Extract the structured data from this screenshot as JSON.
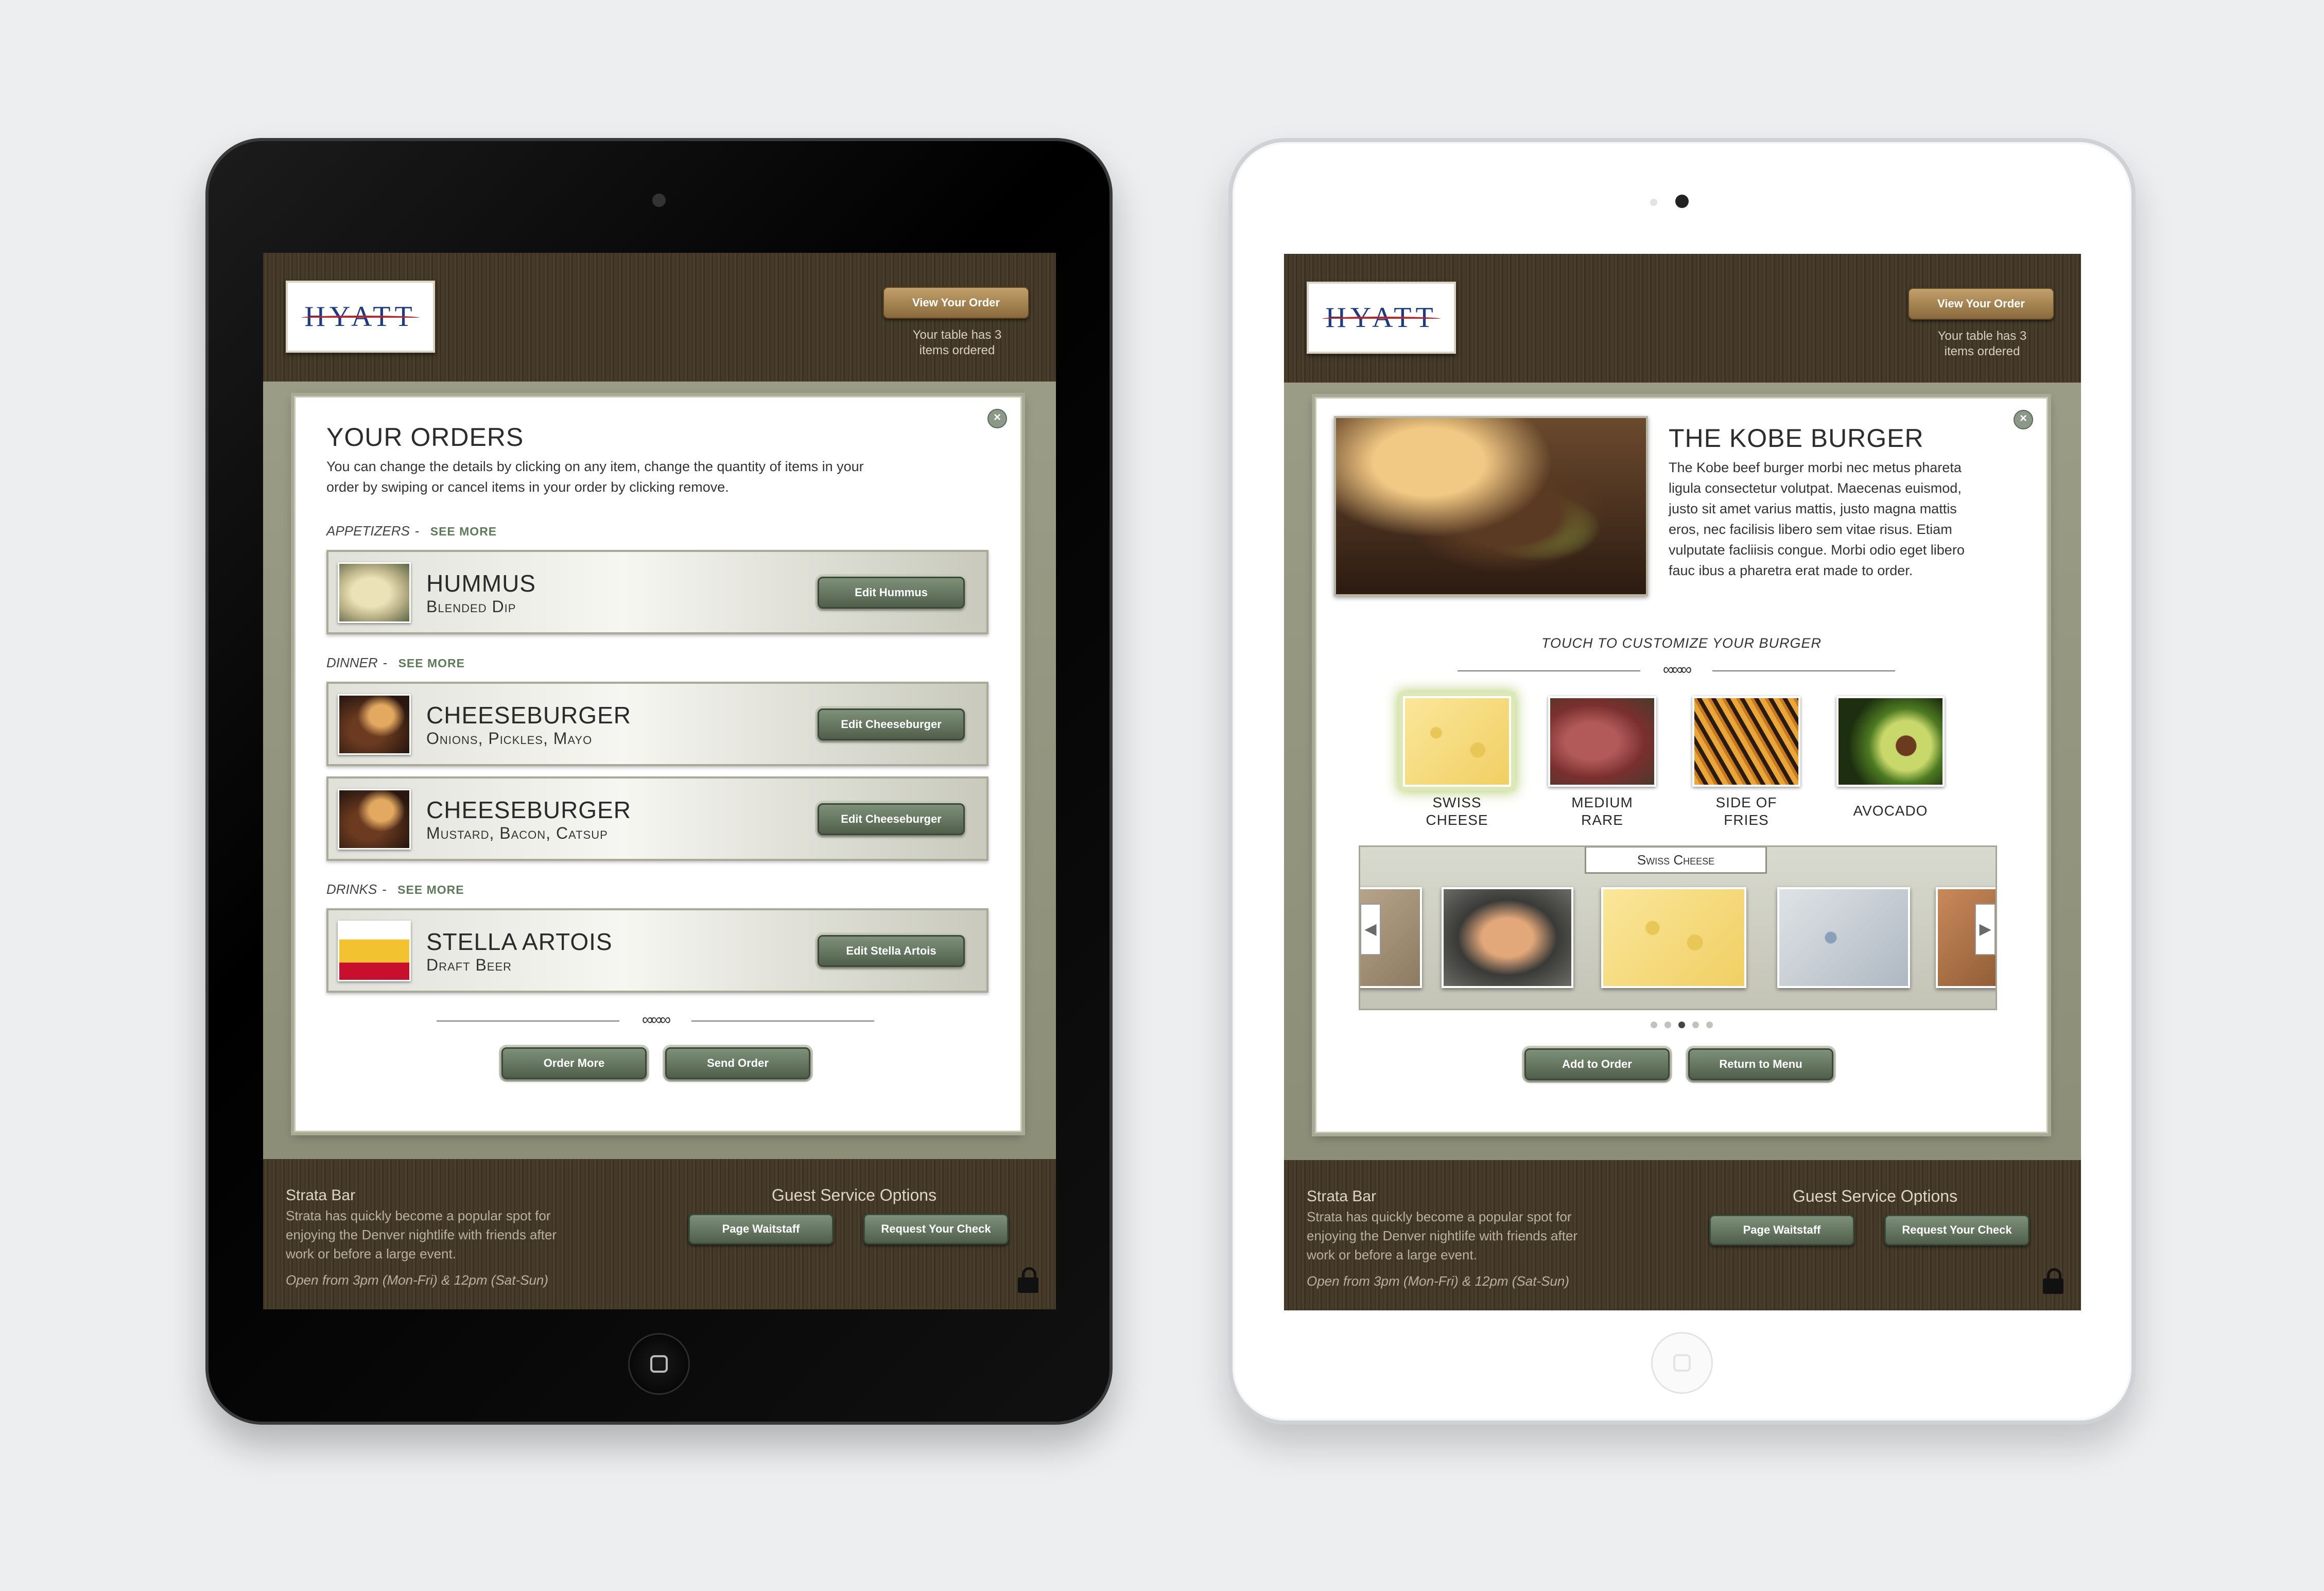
{
  "brand": "HYATT",
  "header": {
    "view_order_label": "View Your Order",
    "table_note_line1": "Your table has 3",
    "table_note_line2": "items ordered"
  },
  "footer": {
    "venue": "Strata Bar",
    "desc_line1": "Strata has quickly become a popular spot for",
    "desc_line2": "enjoying the Denver nightlife with friends after",
    "desc_line3": "work or before a large event.",
    "hours": "Open from 3pm (Mon-Fri) & 12pm (Sat-Sun)",
    "guest_service_title": "Guest Service Options",
    "page_waitstaff_label": "Page Waitstaff",
    "request_check_label": "Request Your Check"
  },
  "orders": {
    "title": "YOUR ORDERS",
    "desc_line1": "You can change the details by clicking on any item, change the quantity of items in your",
    "desc_line2": "order by swiping or cancel items in your order by clicking remove.",
    "see_more": "SEE MORE",
    "categories": [
      {
        "name": "APPETIZERS"
      },
      {
        "name": "DINNER"
      },
      {
        "name": "DRINKS"
      }
    ],
    "items": [
      {
        "name": "HUMMUS",
        "sub": "Blended Dip",
        "button": "Edit Hummus"
      },
      {
        "name": "CHEESEBURGER",
        "sub": "Onions, Pickles, Mayo",
        "button": "Edit Cheeseburger"
      },
      {
        "name": "CHEESEBURGER",
        "sub": "Mustard, Bacon, Catsup",
        "button": "Edit Cheeseburger"
      },
      {
        "name": "STELLA ARTOIS",
        "sub": "Draft Beer",
        "button": "Edit Stella Artois"
      }
    ],
    "order_more_label": "Order More",
    "send_order_label": "Send Order"
  },
  "burger": {
    "title": "THE KOBE BURGER",
    "desc_lines": [
      "The Kobe beef burger morbi nec metus phareta",
      "ligula consectetur volutpat. Maecenas euismod,",
      "justo sit amet varius mattis, justo magna mattis",
      "eros, nec facilisis libero sem vitae risus. Etiam",
      "vulputate facliisis congue. Morbi odio eget libero",
      "fauc ibus a pharetra erat made to order."
    ],
    "customize_prompt": "TOUCH TO CUSTOMIZE YOUR BURGER",
    "options": [
      {
        "line1": "SWISS",
        "line2": "CHEESE"
      },
      {
        "line1": "MEDIUM",
        "line2": "RARE"
      },
      {
        "line1": "SIDE OF",
        "line2": "FRIES"
      },
      {
        "line1": "AVOCADO",
        "line2": ""
      }
    ],
    "carousel_label": "Swiss Cheese",
    "carousel_active_page": 3,
    "carousel_pages": 5,
    "add_to_order_label": "Add to Order",
    "return_to_menu_label": "Return to Menu"
  }
}
